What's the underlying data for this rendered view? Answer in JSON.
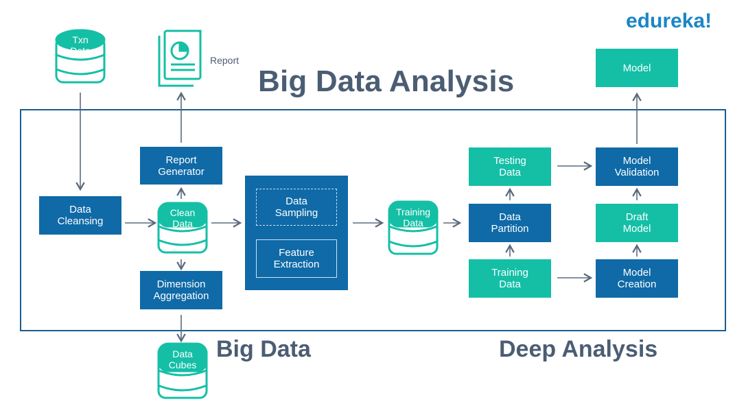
{
  "brand": {
    "logo_text": "edureka!"
  },
  "title": "Big Data Analysis",
  "sections": {
    "big_data": "Big Data",
    "deep_analysis": "Deep Analysis"
  },
  "nodes": {
    "txn_data": "Txn\nData",
    "report": "Report",
    "data_cleansing": "Data\nCleansing",
    "clean_data": "Clean\nData",
    "report_generator": "Report\nGenerator",
    "dimension_aggregation": "Dimension\nAggregation",
    "data_cubes": "Data\nCubes",
    "data_sampling": "Data\nSampling",
    "feature_extraction": "Feature\nExtraction",
    "training_data_db": "Training\nData",
    "testing_data": "Testing\nData",
    "data_partition": "Data\nPartition",
    "training_data_box": "Training\nData",
    "model_validation": "Model\nValidation",
    "draft_model": "Draft\nModel",
    "model_creation": "Model\nCreation",
    "model": "Model"
  },
  "colors": {
    "dark_box": "#0f6aa7",
    "teal": "#14bfa6",
    "frame": "#1b5c8f",
    "arrow": "#5a6b7e",
    "text": "#4b5d73"
  }
}
